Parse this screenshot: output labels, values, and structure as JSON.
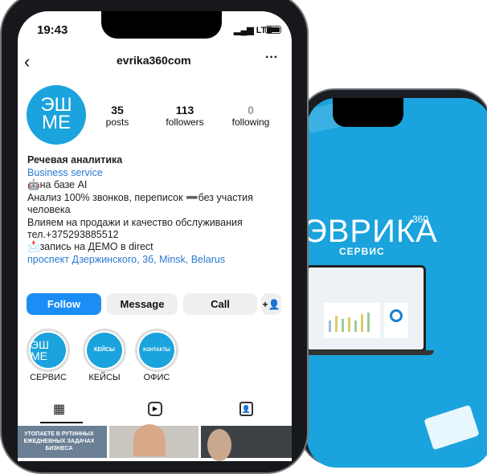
{
  "status": {
    "time": "19:43",
    "network": "LTE"
  },
  "header": {
    "username": "evrika360com"
  },
  "avatar": {
    "text_top": "ЭШ",
    "text_bottom": "МЕ"
  },
  "stats": [
    {
      "value": "35",
      "label": "posts"
    },
    {
      "value": "113",
      "label": "followers"
    },
    {
      "value": "0",
      "label": "following"
    }
  ],
  "bio": {
    "name": "Речевая аналитика",
    "category": "Business service",
    "lines": [
      "🤖на базе AI",
      "Анализ 100% звонков, переписок ➖без участия",
      "человека",
      "Влияем на продажи и качество обслуживания",
      "тел.+375293885512",
      "📩запись на ДЕМО в direct"
    ],
    "address": "проспект Дзержинского, 3б, Minsk, Belarus"
  },
  "buttons": {
    "follow": "Follow",
    "message": "Message",
    "call": "Call"
  },
  "highlights": [
    {
      "label": "СЕРВИС",
      "cover": "ЭШ МЕ"
    },
    {
      "label": "КЕЙСЫ",
      "cover": "КЕЙСЫ"
    },
    {
      "label": "ОФИС",
      "cover": "КОНТАКТЫ"
    }
  ],
  "posts": [
    {
      "caption": "УТОПАЕТЕ В РУТИННЫХ ЕЖЕДНЕВНЫХ ЗАДАЧАХ БИЗНЕСА"
    }
  ],
  "promo": {
    "brand": "ЭВРИКА",
    "sup": "360",
    "sub": "СЕРВИС"
  },
  "colors": {
    "accent": "#1a8ef5",
    "brand_blue": "#1aa3dc"
  }
}
